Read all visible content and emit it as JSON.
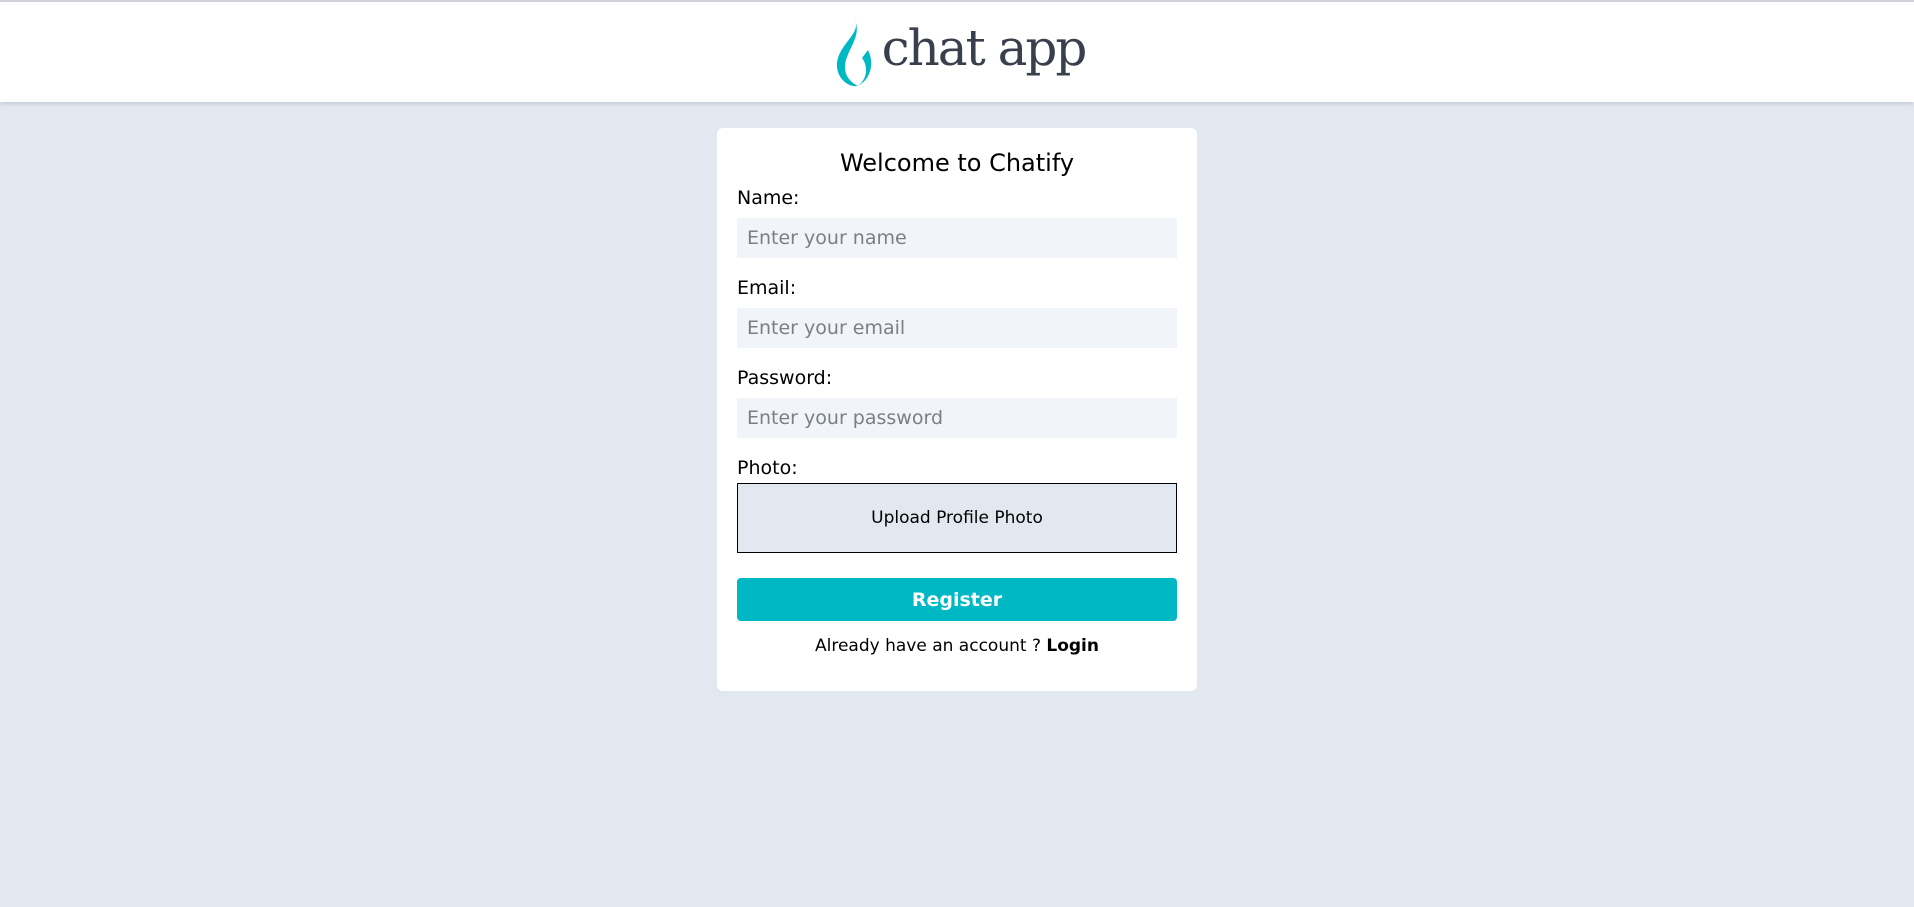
{
  "header": {
    "logo_text": "chat app",
    "brand_color": "#00b8c4",
    "logo_icon": "flame-icon"
  },
  "form": {
    "title": "Welcome to Chatify",
    "name_label": "Name:",
    "name_placeholder": "Enter your name",
    "name_value": "",
    "email_label": "Email:",
    "email_placeholder": "Enter your email",
    "email_value": "",
    "password_label": "Password:",
    "password_placeholder": "Enter your password",
    "password_value": "",
    "photo_label": "Photo:",
    "upload_label": "Upload Profile Photo",
    "register_label": "Register",
    "account_prompt": "Already have an account ?",
    "login_label": "Login"
  },
  "colors": {
    "page_background": "#e2e8f0",
    "input_background": "#f1f5f9",
    "button_background": "#00b8c4"
  }
}
